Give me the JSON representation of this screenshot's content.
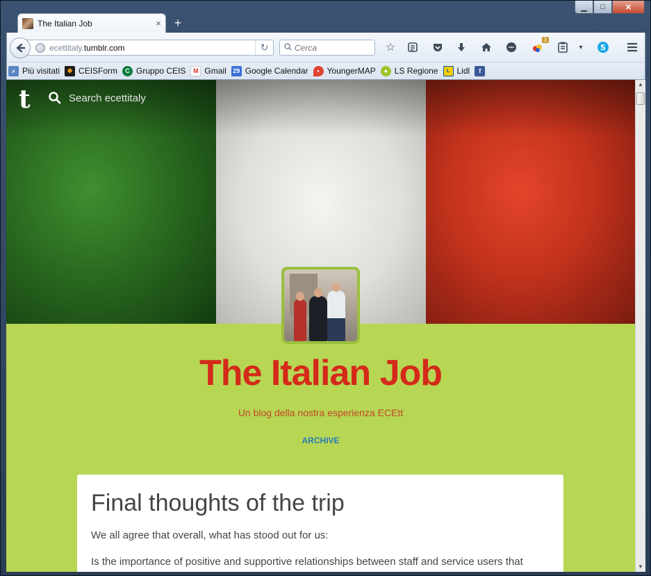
{
  "browser": {
    "tab_title": "The Italian Job",
    "new_tab": "+",
    "tab_close": "×",
    "url_prefix": "ecettitaly.",
    "url_domain": "tumblr.com",
    "search_placeholder": "Cerca",
    "notification_count": "3"
  },
  "bookmarks": [
    {
      "label": "Più visitati",
      "icon": "most-visited-icon"
    },
    {
      "label": "CEISForm",
      "icon": "ceisform-icon"
    },
    {
      "label": "Gruppo CEIS",
      "icon": "gruppo-ceis-icon"
    },
    {
      "label": "Gmail",
      "icon": "gmail-icon"
    },
    {
      "label": "Google Calendar",
      "icon": "calendar-icon",
      "glyph": "29"
    },
    {
      "label": "YoungerMAP",
      "icon": "map-pin-icon"
    },
    {
      "label": "LS Regione",
      "icon": "ls-regione-icon"
    },
    {
      "label": "Lidl",
      "icon": "lidl-icon"
    },
    {
      "label": "",
      "icon": "facebook-icon",
      "glyph": "f"
    }
  ],
  "site": {
    "search_placeholder": "Search ecettitaly",
    "title": "The Italian Job",
    "description": "Un blog della nostra esperienza ECEtt",
    "archive": "ARCHIVE"
  },
  "post": {
    "title": "Final thoughts of the trip",
    "paragraphs": [
      "We all agree that overall, what has stood out for us:",
      "Is the importance of positive and supportive relationships between staff and service users that"
    ]
  },
  "colors": {
    "page_bg": "#b7d653",
    "title": "#d42a1a",
    "archive_link": "#2b7bb9"
  }
}
